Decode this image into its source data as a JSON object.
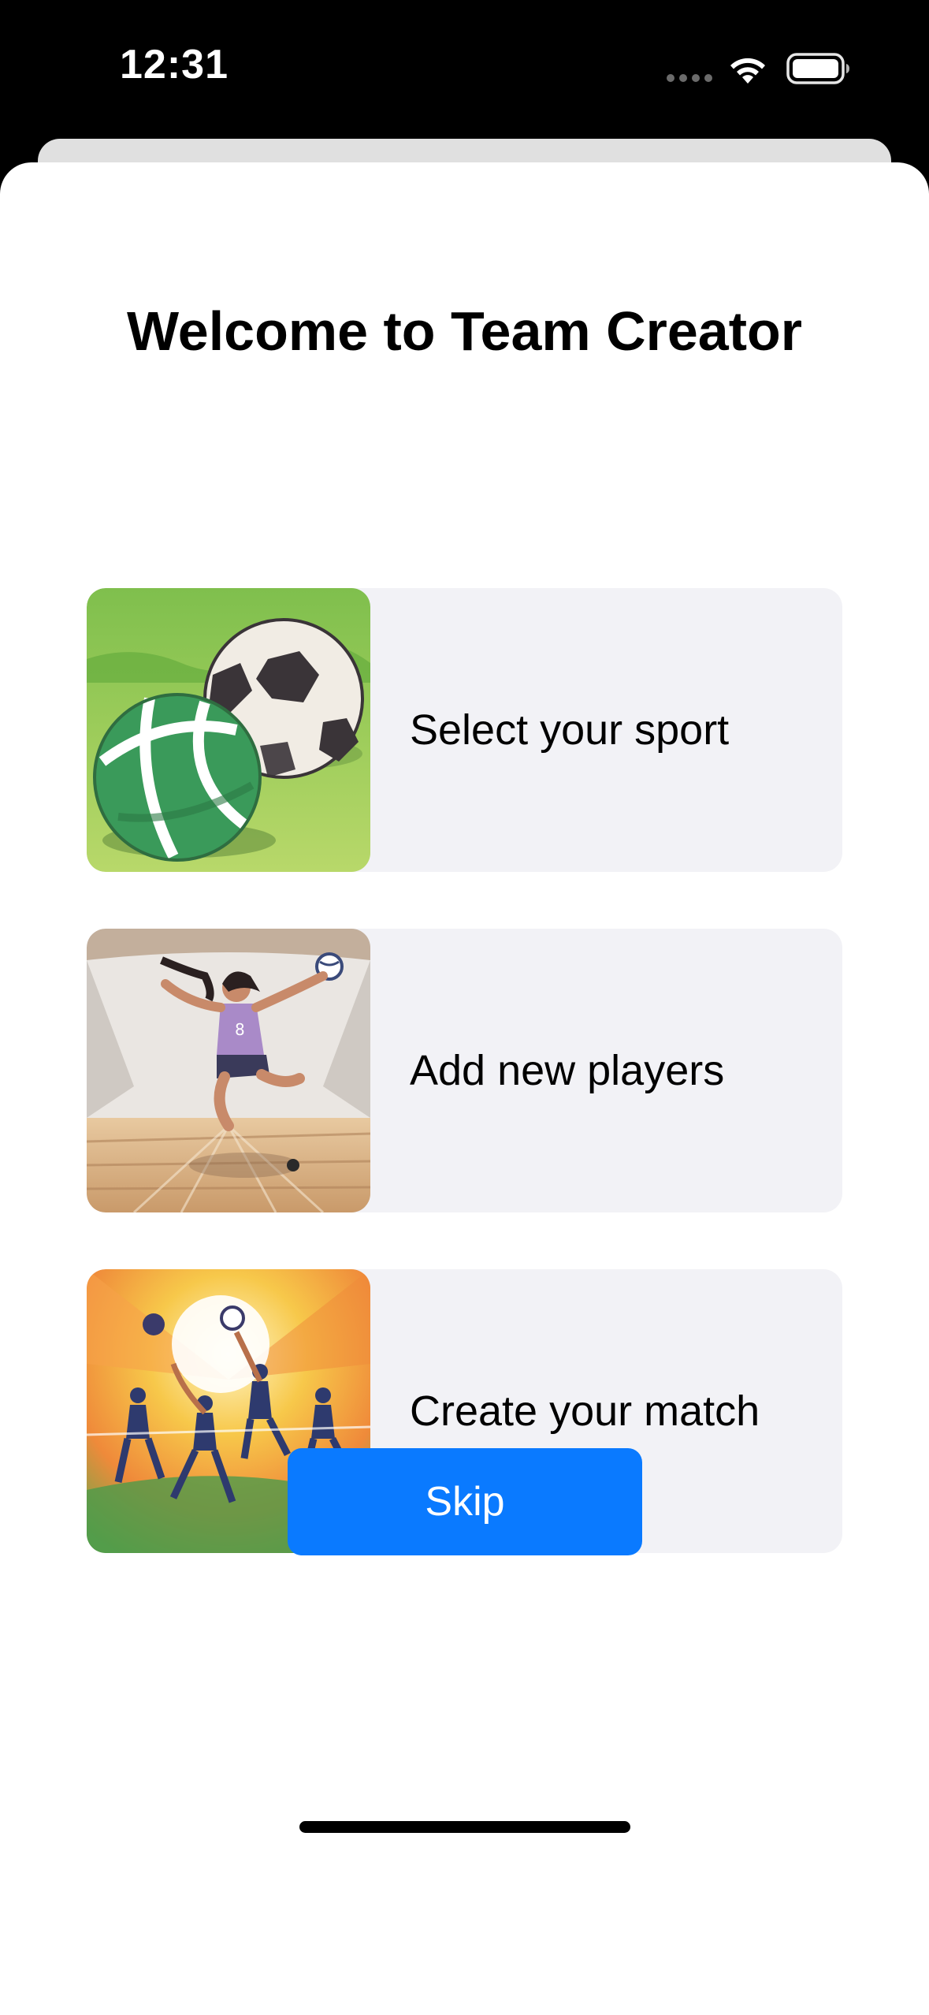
{
  "status_bar": {
    "time": "12:31",
    "wifi_icon": "wifi-icon",
    "battery_icon": "battery-icon"
  },
  "main": {
    "title": "Welcome to Team Creator",
    "cards": [
      {
        "label": "Select your sport",
        "image_icon": "sport-balls-illustration"
      },
      {
        "label": "Add new players",
        "image_icon": "volleyball-player-illustration"
      },
      {
        "label": "Create your match",
        "image_icon": "volleyball-match-illustration"
      }
    ],
    "skip_label": "Skip"
  },
  "colors": {
    "accent": "#0a7aff",
    "card_background": "#f2f2f6",
    "sheet_background": "#ffffff",
    "status_bar_background": "#000000"
  }
}
